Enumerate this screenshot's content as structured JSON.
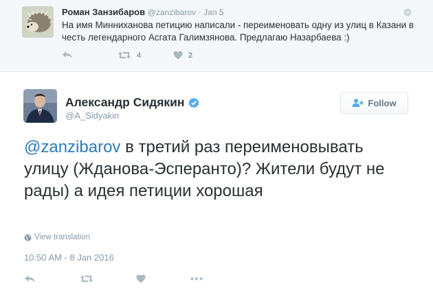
{
  "parent_tweet": {
    "author_name": "Роман Занзибаров",
    "author_handle": "@zanzibarov",
    "separator": "·",
    "date": "Jan 5",
    "text": "На имя Минниханова петицию написали - переименовать одну из улиц в Казани в честь легендарного Асгата Галимзянова. Предлагаю Назарбаева :)",
    "actions": {
      "reply_icon": "reply-icon",
      "retweet_icon": "retweet-icon",
      "retweet_count": "4",
      "like_icon": "heart-icon",
      "like_count": "2"
    }
  },
  "main_tweet": {
    "author_name": "Александр Сидякин",
    "author_handle": "@A_Sidyakin",
    "verified": true,
    "follow_label": "Follow",
    "mention": "@zanzibarov",
    "text": " в третий раз переименовывать улицу (Жданова-Эсперанто)? Жители будут не рады) а идея петиции хорошая",
    "view_translation_label": "View translation",
    "timestamp": "10:50 AM - 8 Jan 2016",
    "actions": [
      "reply-icon",
      "retweet-icon",
      "heart-icon",
      "more-icon"
    ]
  },
  "colors": {
    "link": "#2b7bb9",
    "muted": "#8899a6",
    "verified": "#55acee",
    "parent_bg": "#f5f8fa"
  }
}
